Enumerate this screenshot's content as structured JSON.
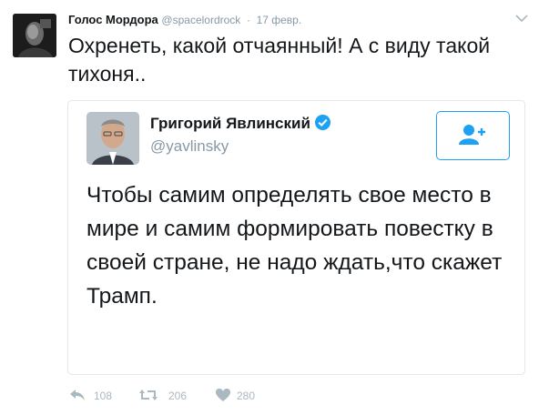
{
  "tweet": {
    "author_name": "Голос Мордора",
    "author_handle": "@spacelordrock",
    "separator": "·",
    "timestamp": "17 февр.",
    "text": "Охренеть, какой отчаянный! А с виду такой тихоня..",
    "icons": {
      "avatar": "avatar",
      "menu": "chevron-down-icon"
    }
  },
  "quoted": {
    "name": "Григорий Явлинский",
    "handle": "@yavlinsky",
    "verified_icon": "verified-badge-icon",
    "follow_icon": "follow-user-icon",
    "text": "Чтобы самим определять свое место в мире и самим формировать повестку в своей стране, не надо ждать,что скажет Трамп."
  },
  "actions": {
    "reply": {
      "icon": "reply-icon",
      "count": "108"
    },
    "retweet": {
      "icon": "retweet-icon",
      "count": "206"
    },
    "like": {
      "icon": "heart-icon",
      "count": "280"
    }
  },
  "colors": {
    "accent": "#1da1f2",
    "text": "#14171a",
    "muted": "#8899a6",
    "action_gray": "#aab8c2",
    "border": "#e1e8ed"
  }
}
